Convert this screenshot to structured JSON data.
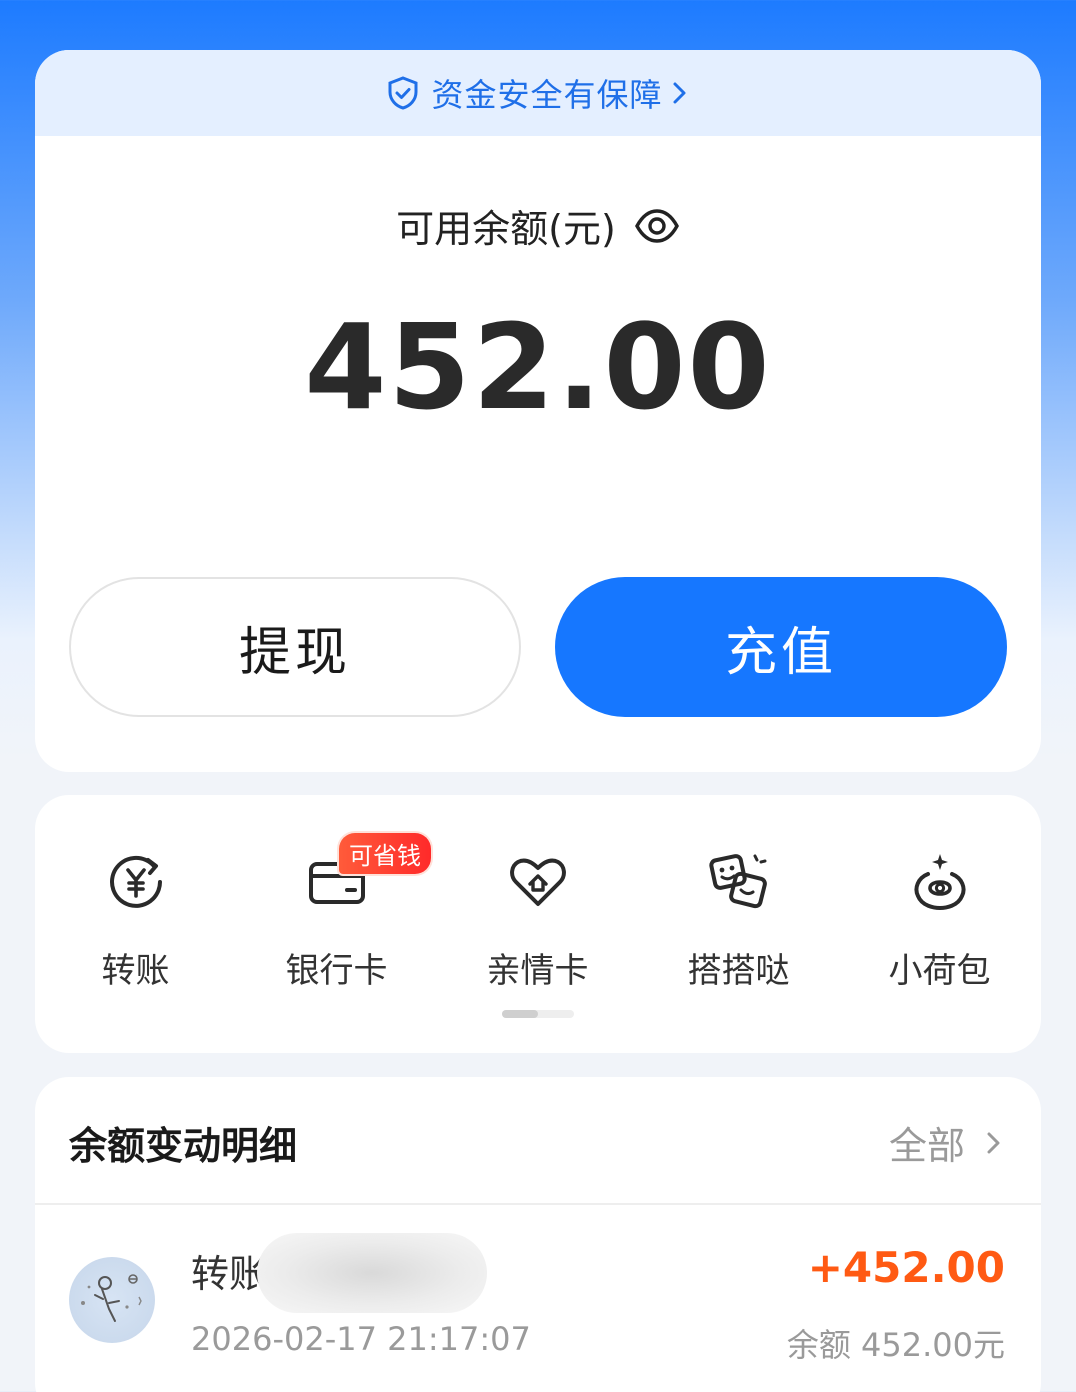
{
  "security": {
    "text": "资金安全有保障"
  },
  "balance": {
    "label": "可用余额(元)",
    "amount": "452.00",
    "withdraw_label": "提现",
    "recharge_label": "充值"
  },
  "shortcuts": {
    "items": [
      {
        "label": "转账",
        "icon": "transfer-icon"
      },
      {
        "label": "银行卡",
        "icon": "bank-card-icon",
        "badge": "可省钱"
      },
      {
        "label": "亲情卡",
        "icon": "family-card-icon"
      },
      {
        "label": "搭搭哒",
        "icon": "dadada-icon"
      },
      {
        "label": "小荷包",
        "icon": "purse-icon"
      }
    ]
  },
  "details": {
    "title": "余额变动明细",
    "all_label": "全部",
    "rows": [
      {
        "title": "转账",
        "time": "2026-02-17 21:17:07",
        "amount": "+452.00",
        "balance": "余额 452.00元"
      }
    ]
  },
  "colors": {
    "accent": "#1677ff",
    "amount_positive": "#ff5a13",
    "badge": "#ff3b2f"
  }
}
